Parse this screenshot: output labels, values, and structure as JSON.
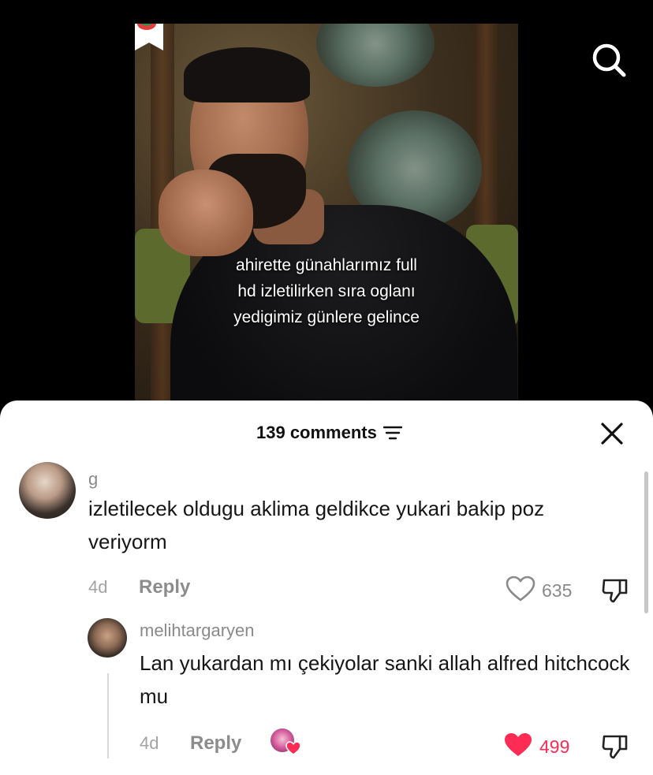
{
  "video": {
    "caption_lines": [
      "ahirette günahlarımız full",
      "hd izletilirken sıra oglanı",
      "yedigimiz günlere gelince"
    ]
  },
  "icons": {
    "search": "search-icon",
    "close": "close-icon",
    "filter": "filter-icon",
    "heart_outline": "heart-outline-icon",
    "heart_filled": "heart-filled-icon",
    "dislike": "dislike-icon",
    "bookmark": "bookmark-icon"
  },
  "colors": {
    "like_active": "#fe2c55",
    "muted_text": "#8a8a8a",
    "sheet_bg": "#ffffff"
  },
  "comments_header": {
    "count_label": "139 comments"
  },
  "comments": [
    {
      "username": "g",
      "text": "izletilecek oldugu aklima geldikce yukari bakip poz veriyorm",
      "time": "4d",
      "reply_label": "Reply",
      "likes": "635",
      "liked": false
    },
    {
      "username": "melihtargaryen",
      "text": "Lan yukardan mı çekiyolar sanki allah alfred hitchcock mu",
      "time": "4d",
      "reply_label": "Reply",
      "likes": "499",
      "liked": true,
      "liked_by_creator": true
    }
  ]
}
